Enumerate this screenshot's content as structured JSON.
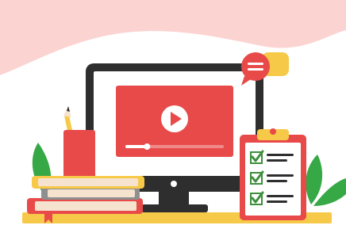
{
  "illustration": {
    "colors": {
      "background": "#fbd3d1",
      "hill": "#ffffff",
      "monitor_frame": "#2e2e2e",
      "screen": "#ffffff",
      "video_panel": "#e84a4a",
      "play_button": "#ffffff",
      "progress_track": "#f08a8a",
      "progress_fill": "#ffffff",
      "desk": "#f7c948",
      "book_red": "#e84a4a",
      "book_pages": "#f5e3d0",
      "book_gray": "#8f8f8f",
      "book_yellow": "#f7c948",
      "pencil_cup": "#e84a4a",
      "clipboard_board": "#e84a4a",
      "clipboard_paper": "#ffffff",
      "check": "#3d8f3d",
      "leaf": "#37a846",
      "chat_red": "#e84a4a",
      "chat_yellow": "#f7c948"
    },
    "video_progress": 0.22,
    "checklist_items": 3,
    "icons": [
      "play-icon",
      "chat-bubble-icon",
      "check-icon",
      "pencil-icon",
      "leaf-icon",
      "book-icon",
      "clipboard-icon"
    ]
  }
}
